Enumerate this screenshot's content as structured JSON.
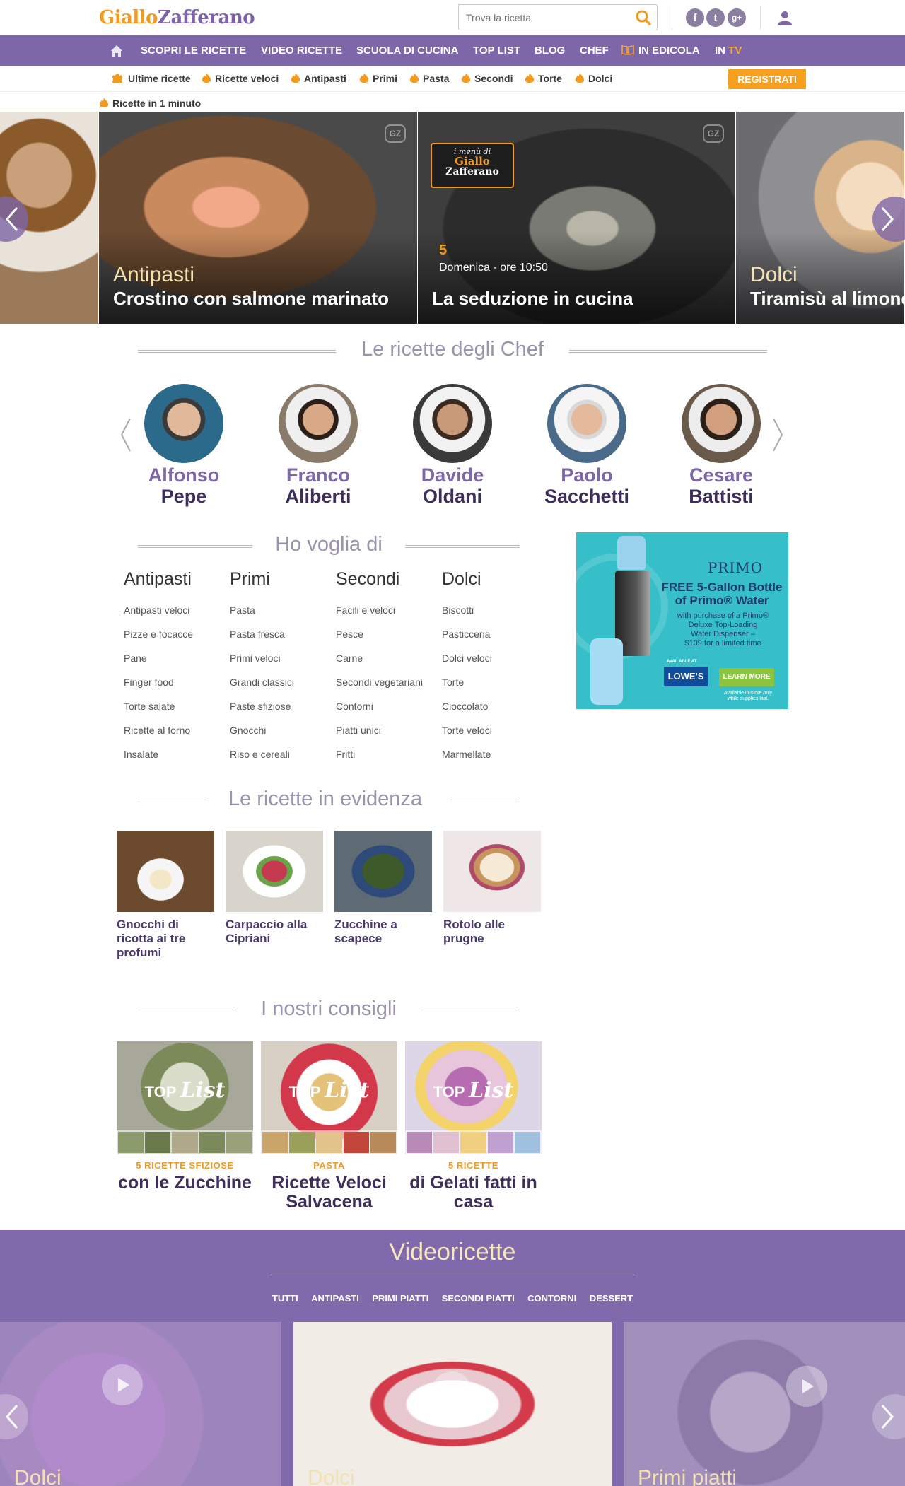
{
  "header": {
    "logo_part1": "Giallo",
    "logo_part2": "Zafferano",
    "search_placeholder": "Trova la ricetta"
  },
  "main_nav": {
    "items": [
      "SCOPRI LE RICETTE",
      "VIDEO RICETTE",
      "SCUOLA DI CUCINA",
      "TOP LIST",
      "BLOG",
      "CHEF",
      "IN EDICOLA"
    ],
    "tv_prefix": "IN ",
    "tv_label": "TV"
  },
  "sub_nav": {
    "items": [
      "Ultime ricette",
      "Ricette veloci",
      "Antipasti",
      "Primi",
      "Pasta",
      "Secondi",
      "Torte",
      "Dolci"
    ],
    "register": "REGISTRATI",
    "one_minute": "Ricette in 1 minuto"
  },
  "hero": {
    "slides": [
      {
        "category": "Antipasti",
        "title": "Crostino con salmone marinato"
      },
      {
        "logo_line1": "i menù di",
        "logo_line2": "Giallo",
        "logo_line3": "Zafferano",
        "channel": "5",
        "subtitle": "Domenica - ore 10:50",
        "title": "La seduzione in cucina"
      },
      {
        "category": "Dolci",
        "title": "Tiramisù al limone"
      }
    ]
  },
  "chefs": {
    "title": "Le ricette degli Chef",
    "items": [
      {
        "first": "Alfonso",
        "last": "Pepe"
      },
      {
        "first": "Franco",
        "last": "Aliberti"
      },
      {
        "first": "Davide",
        "last": "Oldani"
      },
      {
        "first": "Paolo",
        "last": "Sacchetti"
      },
      {
        "first": "Cesare",
        "last": "Battisti"
      }
    ]
  },
  "voglia": {
    "title": "Ho voglia di",
    "columns": [
      {
        "head": "Antipasti",
        "links": [
          "Antipasti veloci",
          "Pizze e focacce",
          "Pane",
          "Finger food",
          "Torte salate",
          "Ricette al forno",
          "Insalate"
        ]
      },
      {
        "head": "Primi",
        "links": [
          "Pasta",
          "Pasta fresca",
          "Primi veloci",
          "Grandi classici",
          "Paste sfiziose",
          "Gnocchi",
          "Riso e cereali"
        ]
      },
      {
        "head": "Secondi",
        "links": [
          "Facili e veloci",
          "Pesce",
          "Carne",
          "Secondi vegetariani",
          "Contorni",
          "Piatti unici",
          "Fritti"
        ]
      },
      {
        "head": "Dolci",
        "links": [
          "Biscotti",
          "Pasticceria",
          "Dolci veloci",
          "Torte",
          "Cioccolato",
          "Torte veloci",
          "Marmellate"
        ]
      }
    ]
  },
  "ad": {
    "brand": "PRIMO",
    "headline1": "FREE 5-Gallon Bottle",
    "headline2": "of Primo® Water",
    "body1": "with purchase of a Primo®",
    "body2": "Deluxe Top-Loading",
    "body3": "Water Dispenser –",
    "body4": "$109 for a limited time",
    "available": "AVAILABLE AT",
    "store": "LOWE'S",
    "cta": "LEARN MORE",
    "fine1": "Available in-store only",
    "fine2": "while supplies last."
  },
  "evidenza": {
    "title": "Le ricette in evidenza",
    "items": [
      "Gnocchi di ricotta ai tre profumi",
      "Carpaccio alla Cipriani",
      "Zucchine a scapece",
      "Rotolo alle prugne"
    ]
  },
  "consigli": {
    "title": "I nostri consigli",
    "badge_top": "TOP",
    "badge_list": "List",
    "items": [
      {
        "kicker": "5 RICETTE SFIZIOSE",
        "title": "con le Zucchine"
      },
      {
        "kicker": "PASTA",
        "title": "Ricette Veloci Salvacena"
      },
      {
        "kicker": "5 RICETTE",
        "title": "di Gelati fatti in casa"
      }
    ]
  },
  "videoricette": {
    "title": "Videoricette",
    "tabs": [
      "TUTTI",
      "ANTIPASTI",
      "PRIMI PIATTI",
      "SECONDI PIATTI",
      "CONTORNI",
      "DESSERT"
    ],
    "cards": [
      "Dolci",
      "Dolci",
      "Primi piatti"
    ]
  },
  "colors": {
    "purple": "#7e67a8",
    "orange": "#f7a01f",
    "dark_purple": "#3d2f5a"
  }
}
